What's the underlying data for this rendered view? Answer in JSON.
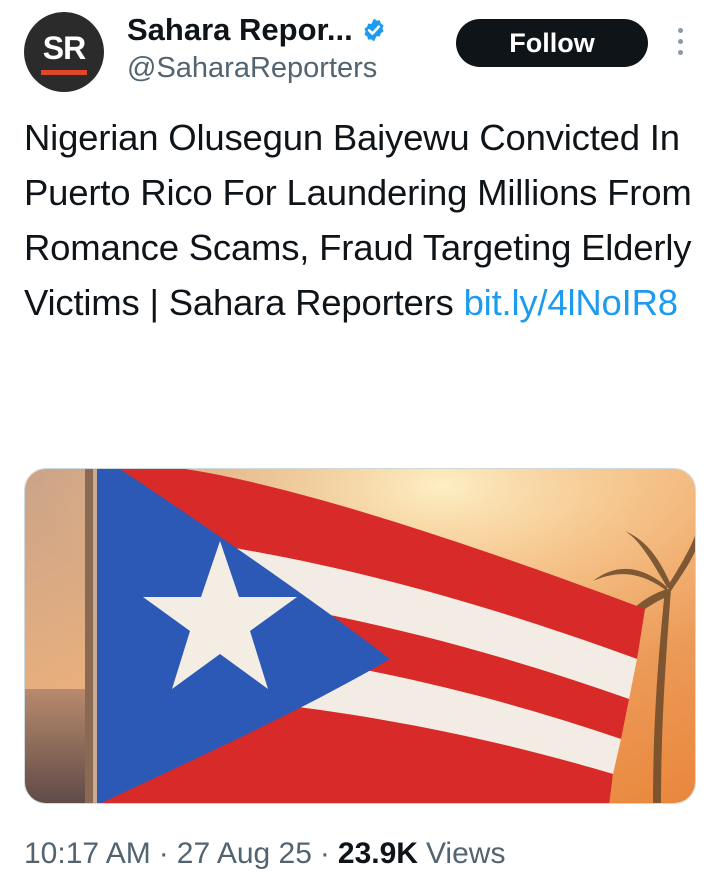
{
  "author": {
    "display_name": "Sahara Repor...",
    "handle": "@SaharaReporters",
    "avatar_text": "SR",
    "verified": true
  },
  "actions": {
    "follow_label": "Follow"
  },
  "tweet": {
    "text": "Nigerian Olusegun Baiyewu Convicted In Puerto Rico For Laundering Millions From Romance Scams, Fraud Targeting Elderly Victims | Sahara Reporters",
    "link": "bit.ly/4lNoIR8"
  },
  "media": {
    "image_icon": "puerto-rico-flag-image"
  },
  "meta": {
    "time": "10:17 AM",
    "separator": "·",
    "date": "27 Aug 25",
    "views_count": "23.9K",
    "views_label": "Views"
  },
  "colors": {
    "accent": "#1d9bf0",
    "follow_bg": "#0f1419",
    "secondary_text": "#536471",
    "avatar_accent": "#e0472a"
  }
}
